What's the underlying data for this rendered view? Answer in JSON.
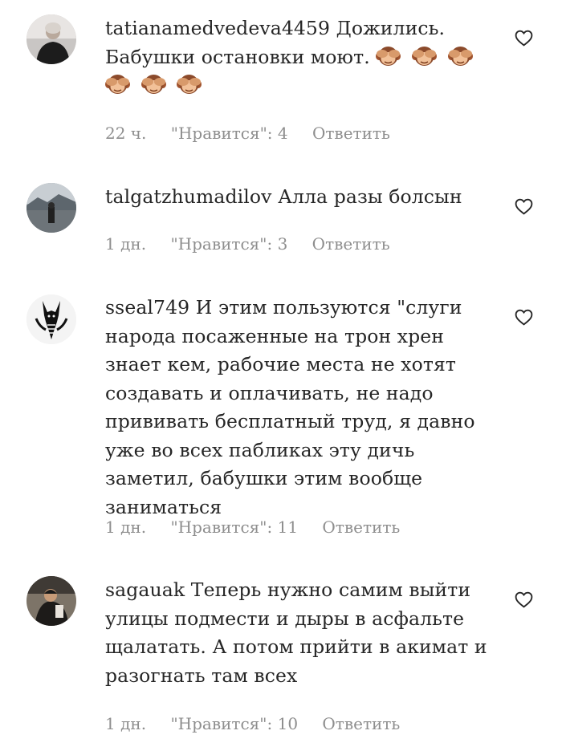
{
  "comments": [
    {
      "username": "tatianamedvedeva4459",
      "text": "Дожились. Бабушки остановки моют.",
      "emoji_icons": [
        "see-no-evil-monkey-icon",
        "see-no-evil-monkey-icon",
        "see-no-evil-monkey-icon",
        "see-no-evil-monkey-icon",
        "see-no-evil-monkey-icon",
        "see-no-evil-monkey-icon"
      ],
      "time": "22 ч.",
      "likes": "\"Нравится\": 4",
      "reply": "Ответить"
    },
    {
      "username": "talgatzhumadilov",
      "text": "Алла разы болсын",
      "time": "1 дн.",
      "likes": "\"Нравится\": 3",
      "reply": "Ответить"
    },
    {
      "username": "sseal749",
      "text": "И этим пользуются \"слуги народа посаженные на трон хрен знает кем, рабочие места не хотят создавать и оплачивать, не надо прививать бесплатный труд, я давно уже во всех пабликах эту дичь заметил, бабушки этим вообще заниматься",
      "time": "1 дн.",
      "likes": "\"Нравится\": 11",
      "reply": "Ответить"
    },
    {
      "username": "sagauak",
      "text": "Теперь нужно самим выйти улицы подмести и дыры в асфальте щалатать. А потом прийти в акимат и разогнать там всех",
      "time": "1 дн.",
      "likes": "\"Нравится\": 10",
      "reply": "Ответить"
    }
  ],
  "colors": {
    "text": "#262626",
    "meta": "#8e8e8e",
    "background": "#ffffff"
  },
  "icons": {
    "like": "heart-outline-icon",
    "emoji": "see-no-evil-monkey-icon"
  }
}
